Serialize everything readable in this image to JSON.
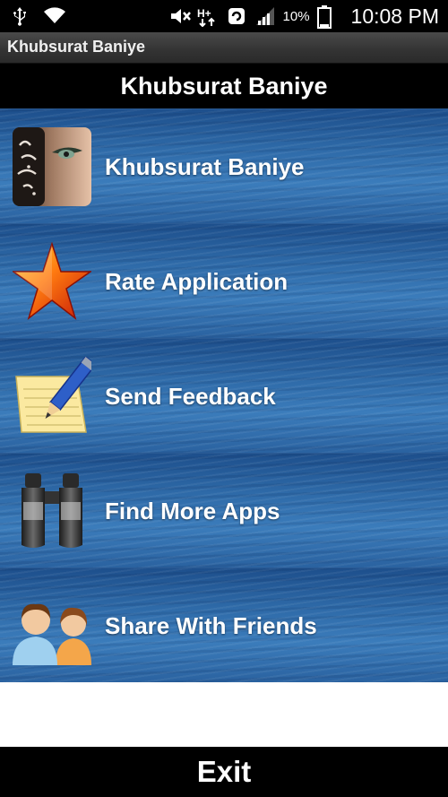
{
  "status_bar": {
    "icons": [
      "usb-icon",
      "wifi-icon",
      "mute-icon",
      "hplus-signal-icon",
      "sync-icon",
      "signal-bars-icon",
      "battery-icon"
    ],
    "battery": "10%",
    "network": "H+",
    "time": "10:08 PM"
  },
  "action_bar": {
    "title": "Khubsurat Baniye"
  },
  "header": {
    "title": "Khubsurat Baniye"
  },
  "menu": {
    "items": [
      {
        "label": "Khubsurat Baniye",
        "icon": "app-logo-icon"
      },
      {
        "label": "Rate Application",
        "icon": "star-icon"
      },
      {
        "label": "Send Feedback",
        "icon": "notepad-pencil-icon"
      },
      {
        "label": "Find More Apps",
        "icon": "binoculars-icon"
      },
      {
        "label": "Share With Friends",
        "icon": "users-icon"
      }
    ]
  },
  "footer": {
    "exit_label": "Exit"
  },
  "colors": {
    "status_bar_bg": "#000000",
    "header_bg": "#000000",
    "menu_water_blue": "#2e6aa8",
    "text": "#ffffff"
  }
}
